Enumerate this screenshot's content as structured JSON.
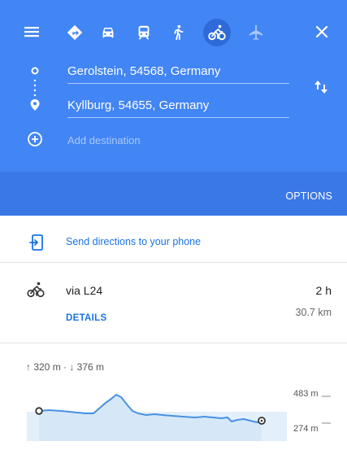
{
  "header": {
    "travel_modes": [
      {
        "name": "best",
        "icon": "directions-diamond-icon",
        "selected": false
      },
      {
        "name": "car",
        "icon": "car-icon",
        "selected": false
      },
      {
        "name": "transit",
        "icon": "transit-icon",
        "selected": false
      },
      {
        "name": "walk",
        "icon": "walk-icon",
        "selected": false
      },
      {
        "name": "bicycle",
        "icon": "bicycle-icon",
        "selected": true
      },
      {
        "name": "flight",
        "icon": "airplane-icon",
        "selected": false
      }
    ],
    "origin": "Gerolstein, 54568, Germany",
    "destination": "Kyllburg, 54655, Germany",
    "add_destination_placeholder": "Add destination",
    "options_label": "OPTIONS"
  },
  "send_directions_label": "Send directions to your phone",
  "route": {
    "via": "via L24",
    "duration": "2 h",
    "distance": "30.7 km",
    "details_label": "DETAILS"
  },
  "elevation": {
    "summary": "↑ 320 m · ↓ 376 m",
    "max_label": "483 m",
    "min_label": "274 m"
  },
  "colors": {
    "header_blue": "#4285f4",
    "options_band": "#3b78e7",
    "link_blue": "#1a73e8",
    "profile_fill": "#e3f0fb",
    "profile_line": "#4a90e2"
  }
}
